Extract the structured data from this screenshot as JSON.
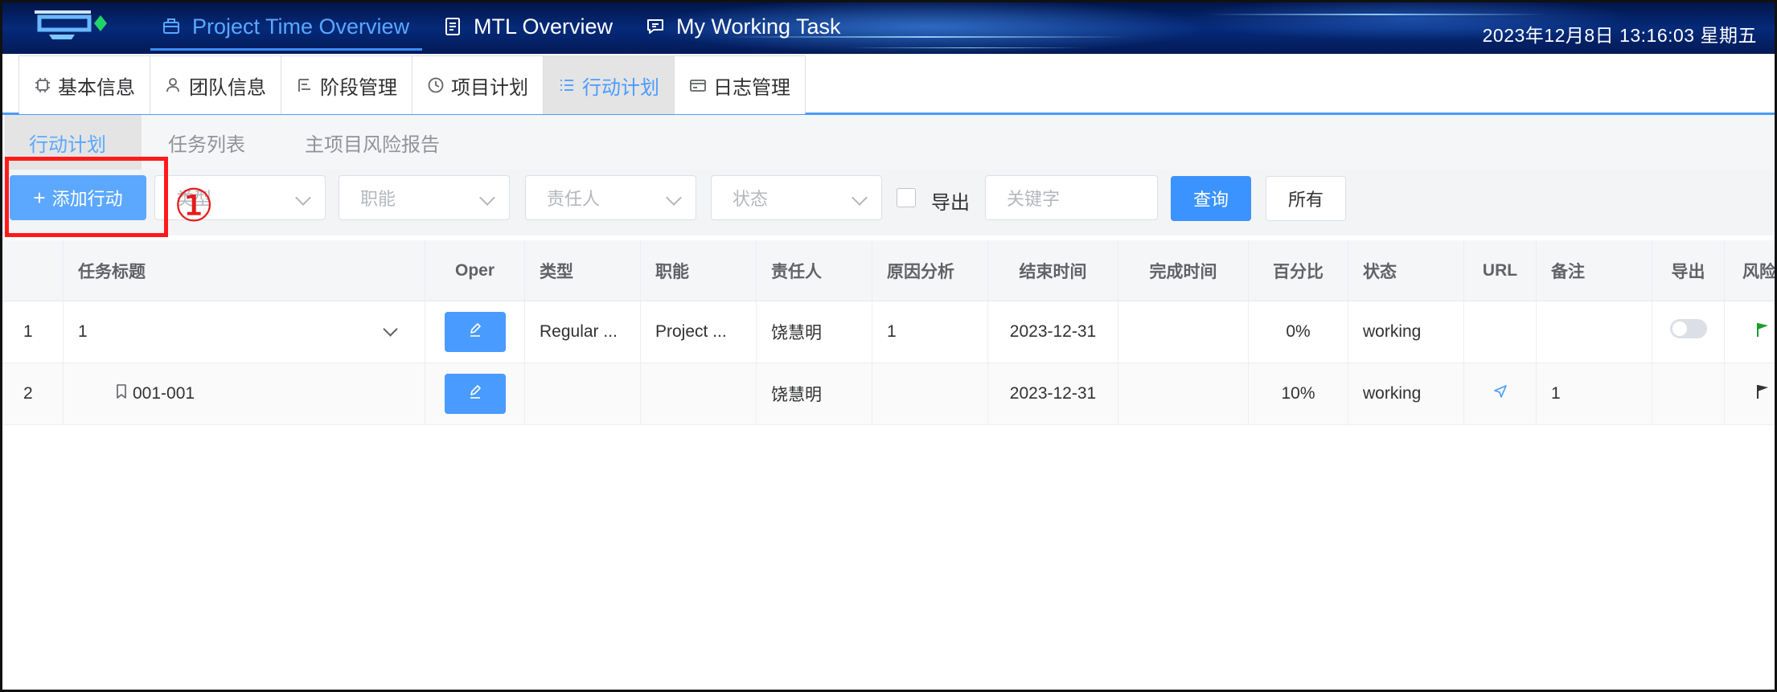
{
  "header": {
    "nav": [
      {
        "label": "Project Time Overview",
        "icon": "briefcase-icon",
        "active": true
      },
      {
        "label": "MTL Overview",
        "icon": "document-icon",
        "active": false
      },
      {
        "label": "My Working Task",
        "icon": "chat-icon",
        "active": false
      }
    ],
    "datetime": "2023年12月8日  13:16:03  星期五"
  },
  "modules": [
    {
      "label": "基本信息",
      "icon": "chip-icon",
      "active": false
    },
    {
      "label": "团队信息",
      "icon": "user-icon",
      "active": false
    },
    {
      "label": "阶段管理",
      "icon": "stages-icon",
      "active": false
    },
    {
      "label": "项目计划",
      "icon": "clock-icon",
      "active": false
    },
    {
      "label": "行动计划",
      "icon": "list-icon",
      "active": true
    },
    {
      "label": "日志管理",
      "icon": "card-icon",
      "active": false
    }
  ],
  "subtabs": [
    {
      "label": "行动计划",
      "active": true
    },
    {
      "label": "任务列表",
      "active": false
    },
    {
      "label": "主项目风险报告",
      "active": false
    }
  ],
  "filters": {
    "add_button": "添加行动",
    "marker": "①",
    "type_placeholder": "类型",
    "function_placeholder": "职能",
    "owner_placeholder": "责任人",
    "status_placeholder": "状态",
    "export_label": "导出",
    "keyword_placeholder": "关键字",
    "query_button": "查询",
    "all_button": "所有"
  },
  "table": {
    "headers": {
      "title": "任务标题",
      "oper": "Oper",
      "type": "类型",
      "function": "职能",
      "owner": "责任人",
      "cause": "原因分析",
      "end": "结束时间",
      "done": "完成时间",
      "percent": "百分比",
      "status": "状态",
      "url": "URL",
      "remark": "备注",
      "export": "导出",
      "risk": "风险"
    },
    "rows": [
      {
        "index": "1",
        "title": "1",
        "type": "Regular ...",
        "function": "Project ...",
        "owner": "饶慧明",
        "cause": "1",
        "end": "2023-12-31",
        "done": "",
        "percent": "0%",
        "status": "working",
        "remark": "",
        "flag_color": "#1a9c2c"
      },
      {
        "index": "2",
        "title": "001-001",
        "type": "",
        "function": "",
        "owner": "饶慧明",
        "cause": "",
        "end": "2023-12-31",
        "done": "",
        "percent": "10%",
        "status": "working",
        "remark": "1",
        "flag_color": "#333333"
      }
    ]
  }
}
